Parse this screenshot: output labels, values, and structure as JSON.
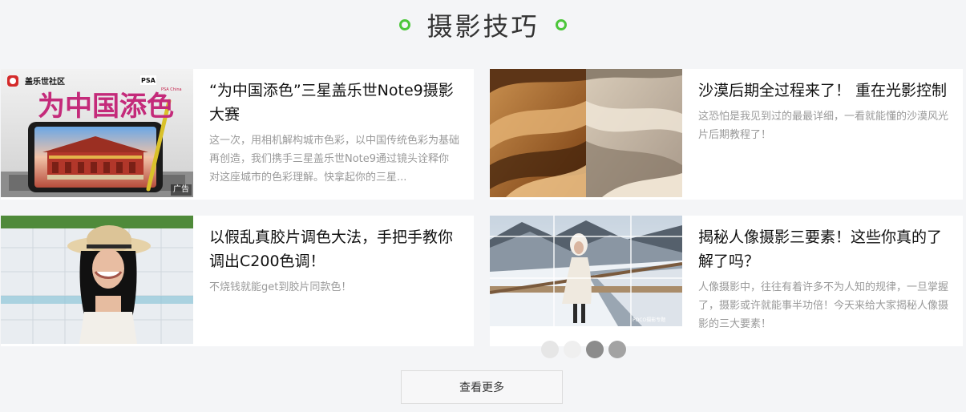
{
  "section": {
    "title": "摄影技巧",
    "accent_color": "#4cc63a"
  },
  "articles": [
    {
      "title": "“为中国添色”三星盖乐世Note9摄影大赛",
      "desc": "这一次，用相机解构城市色彩，以中国传统色彩为基础再创造，我们携手三星盖乐世Note9通过镜头诠释你对这座城市的色彩理解。快拿起你的三星...",
      "image": {
        "brand": "盖乐世社区",
        "headline": "为中国添色",
        "badge": "PSA",
        "badge_sub": "PSA China",
        "ad_label": "广告"
      }
    },
    {
      "title": "沙漠后期全过程来了！ 重在光影控制",
      "desc": "这恐怕是我见到过的最最详细，一看就能懂的沙漠风光片后期教程了！",
      "image": {}
    },
    {
      "title": "以假乱真胶片调色大法，手把手教你调出C200色调！",
      "desc": "不烧钱就能get到胶片同款色！",
      "image": {}
    },
    {
      "title": "揭秘人像摄影三要素！这些你真的了解了吗？",
      "desc": "人像摄影中，往往有着许多不为人知的规律，一旦掌握了，摄影或许就能事半功倍！今天来给大家揭秘人像摄影的三大要素！",
      "image": {
        "watermark": "POCO摄影专题"
      }
    }
  ],
  "more_button": {
    "label": "查看更多"
  }
}
